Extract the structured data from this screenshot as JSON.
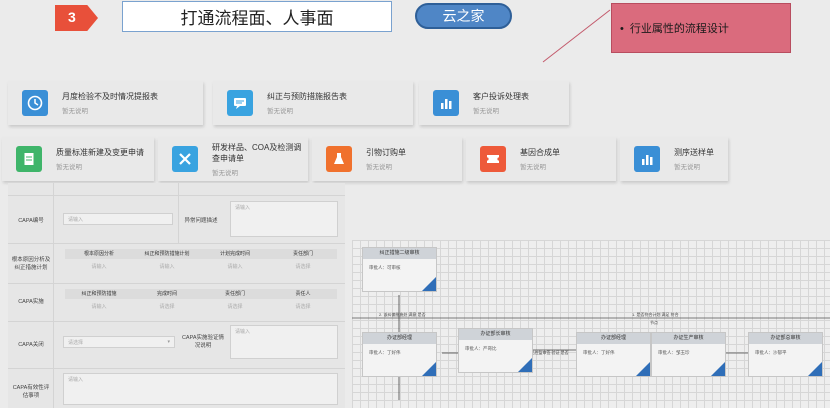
{
  "header": {
    "step_number": "3",
    "title": "打通流程面、人事面",
    "brand_pill": "云之家",
    "callout_text": "行业属性的流程设计"
  },
  "cards_row1": [
    {
      "title": "月度检验不及时情况提报表",
      "subtitle": "暂无说明",
      "icon": "clock-icon",
      "color": "#3a8fd6"
    },
    {
      "title": "纠正与预防措施报告表",
      "subtitle": "暂无说明",
      "icon": "chat-icon",
      "color": "#39a3e0"
    },
    {
      "title": "客户投诉处理表",
      "subtitle": "暂无说明",
      "icon": "bar-chart-icon",
      "color": "#3a8fd6"
    }
  ],
  "cards_row2": [
    {
      "title": "质量标准新建及变更申请",
      "subtitle": "暂无说明",
      "icon": "document-icon",
      "color": "#3fb56a"
    },
    {
      "title": "研发样品、COA及检测调查申请单",
      "subtitle": "暂无说明",
      "icon": "tools-icon",
      "color": "#39a3e0"
    },
    {
      "title": "引物订购单",
      "subtitle": "暂无说明",
      "icon": "flask-icon",
      "color": "#f0712d"
    },
    {
      "title": "基因合成单",
      "subtitle": "暂无说明",
      "icon": "ticket-icon",
      "color": "#ee5a3a"
    },
    {
      "title": "测序送样单",
      "subtitle": "暂无说明",
      "icon": "bar-chart-icon",
      "color": "#3a8fd6"
    }
  ],
  "form": {
    "capa_no_label": "CAPA编号",
    "capa_no_placeholder": "请输入",
    "desc_label": "异常问题描述",
    "desc_placeholder": "请输入",
    "root_label": "根本原因分析及纠正措施计划",
    "table1_headers": [
      "根本原因分析",
      "纠正和预防措施计划",
      "计划完成时间",
      "责任部门"
    ],
    "table1_row": [
      "请输入",
      "请输入",
      "请输入",
      "请选择"
    ],
    "capa_impl_label": "CAPA实施",
    "table2_headers": [
      "纠正和预防措施",
      "完成时间",
      "责任部门",
      "责任人"
    ],
    "table2_row": [
      "请输入",
      "请选择",
      "请选择",
      "请选择"
    ],
    "capa_close_label": "CAPA关闭",
    "capa_close_placeholder": "请选择",
    "verify_label": "CAPA实施验证情况说明",
    "verify_placeholder": "请输入",
    "notes_label": "CAPA有效性评估事项",
    "notes_placeholder": "请输入"
  },
  "flow": {
    "node_top": {
      "title": "纠正措施二级审核",
      "body": "审批人：可审核"
    },
    "node_a": {
      "title": "办证部经理",
      "body": "审批人：丁好伟"
    },
    "node_b": {
      "title": "办证部长审核",
      "body": "审批人：严哥比"
    },
    "node_c": {
      "title": "办证部经理",
      "body": "审批人：丁好伟"
    },
    "node_d": {
      "title": "办证生产审核",
      "body": "审批人：邹玉珍"
    },
    "node_e": {
      "title": "办证部总审核",
      "body": "审批人：沙郁平"
    },
    "edge_label_1": "2. 该纠偏措施处 满意 是否",
    "edge_label_2": "3. 需品控监审签 验证 是否",
    "edge_label_3": "1. 是否符合计划 满足 符合",
    "edge_label_4": "节点"
  }
}
